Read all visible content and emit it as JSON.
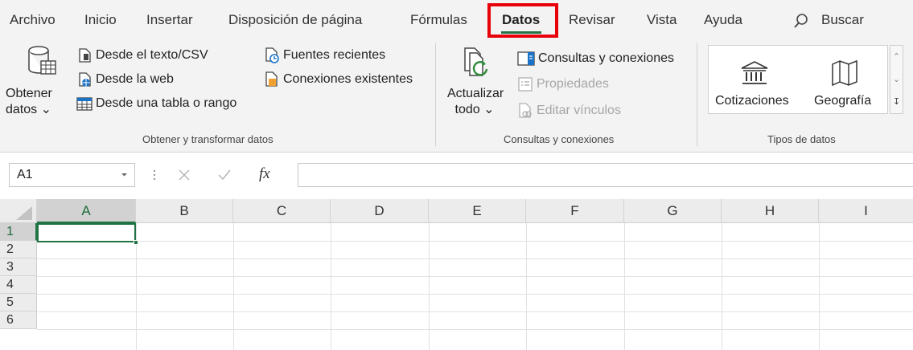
{
  "tabs": [
    {
      "label": "Archivo",
      "name": "tab-archivo",
      "active": false
    },
    {
      "label": "Inicio",
      "name": "tab-inicio",
      "active": false
    },
    {
      "label": "Insertar",
      "name": "tab-insertar",
      "active": false
    },
    {
      "label": "Disposición de página",
      "name": "tab-disposicion",
      "active": false
    },
    {
      "label": "Fórmulas",
      "name": "tab-formulas",
      "active": false
    },
    {
      "label": "Datos",
      "name": "tab-datos",
      "active": true
    },
    {
      "label": "Revisar",
      "name": "tab-revisar",
      "active": false
    },
    {
      "label": "Vista",
      "name": "tab-vista",
      "active": false
    },
    {
      "label": "Ayuda",
      "name": "tab-ayuda",
      "active": false
    }
  ],
  "search": {
    "label": "Buscar",
    "icon": "search-icon"
  },
  "groups": {
    "get_transform": {
      "label": "Obtener y transformar datos",
      "get_data": {
        "line1": "Obtener",
        "line2": "datos ⌄"
      },
      "from_text_csv": "Desde el texto/CSV",
      "from_web": "Desde la web",
      "from_table": "Desde una tabla o rango",
      "recent_sources": "Fuentes recientes",
      "existing_connections": "Conexiones existentes"
    },
    "queries": {
      "label": "Consultas y conexiones",
      "refresh_all": {
        "line1": "Actualizar",
        "line2": "todo ⌄"
      },
      "queries_connections": "Consultas y conexiones",
      "properties": "Propiedades",
      "edit_links": "Editar vínculos"
    },
    "data_types": {
      "label": "Tipos de datos",
      "stocks": "Cotizaciones",
      "geography": "Geografía"
    }
  },
  "formula_bar": {
    "name_box": "A1",
    "fx": "fx",
    "value": ""
  },
  "grid": {
    "columns": [
      "A",
      "B",
      "C",
      "D",
      "E",
      "F",
      "G",
      "H",
      "I"
    ],
    "rows": [
      "1",
      "2",
      "3",
      "4",
      "5",
      "6"
    ],
    "active_cell": "A1"
  },
  "colors": {
    "accent": "#217346",
    "highlight": "#e8000b"
  }
}
